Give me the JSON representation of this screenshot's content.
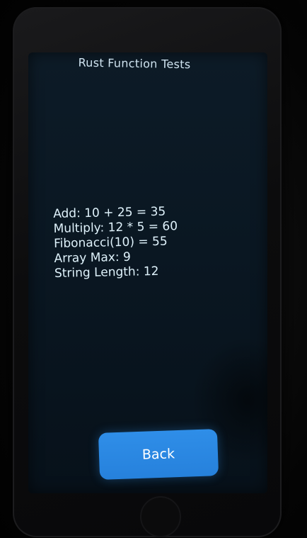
{
  "screen": {
    "title": "Rust Function Tests",
    "results": [
      "Add: 10 + 25 = 35",
      "Multiply: 12 * 5 = 60",
      "Fibonacci(10) = 55",
      "Array Max: 9",
      "String Length: 12"
    ],
    "back_label": "Back"
  },
  "colors": {
    "screen_background": "#0a1722",
    "text": "#dff2fb",
    "button": "#2f8ee8"
  }
}
